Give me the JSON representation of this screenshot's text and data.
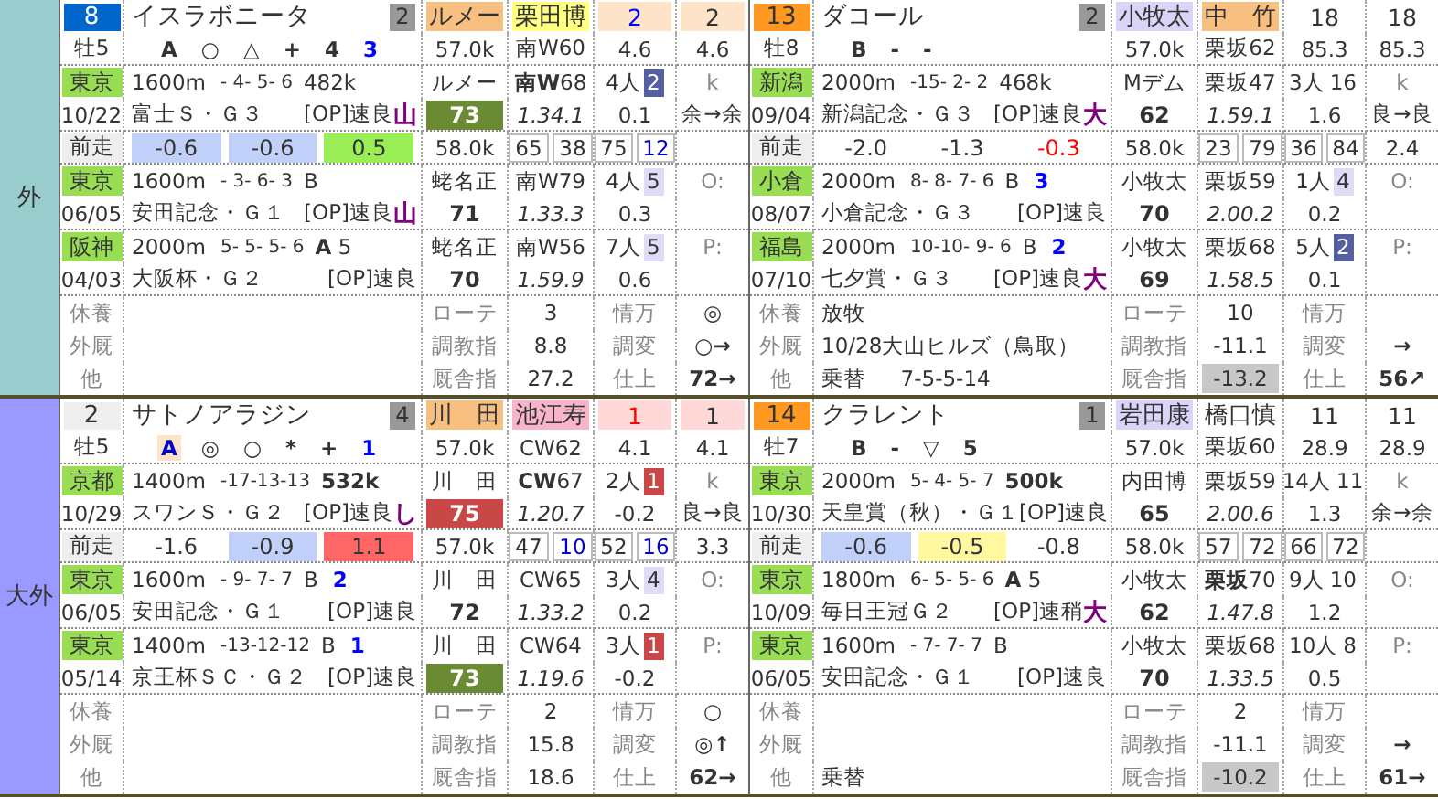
{
  "groups": [
    {
      "label": "外",
      "color": "#99cccc",
      "horses": [
        {
          "frame": {
            "number": "8",
            "color": "#0066cc"
          },
          "name": "イスラボニータ",
          "rank": "2",
          "sex_age": "牡5",
          "marks": [
            {
              "text": "A"
            },
            {
              "text": "○"
            },
            {
              "text": "△"
            },
            {
              "text": "+"
            },
            {
              "text": "4"
            },
            {
              "text": "3",
              "color": "#0000ff"
            }
          ],
          "top": [
            {
              "text": "ルメー",
              "fill": {
                "color": "#f8c080"
              }
            },
            {
              "text": "栗田博",
              "fill": {
                "color": "#ffff80"
              }
            },
            {
              "text": "2",
              "color": "#0000ff",
              "fill": {
                "color": "#fde4c8"
              }
            },
            {
              "text": "2",
              "fill": {
                "color": "#fde4c8"
              }
            }
          ],
          "second": [
            "57.0k",
            "南W60",
            "4.6",
            "4.6"
          ],
          "races": [
            {
              "venue": "東京",
              "date": "10/22",
              "distance": "1600m",
              "passing": "- 4- 5- 6",
              "tag": "482k",
              "name": "富士Ｓ・Ｇ３",
              "class": "[OP]速良",
              "mark": "山",
              "jockey": "ルメー",
              "rating": {
                "text": "73",
                "color": "#6b8a34"
              },
              "course": "**南W**68",
              "time": "1.34.1",
              "pop": "4人",
              "pop_rank": {
                "text": "2",
                "color": "#5560a0"
              },
              "diff": "0.1",
              "note": "k",
              "note2": "余→余"
            },
            {
              "venue": "東京",
              "date": "06/05",
              "distance": "1600m",
              "passing": "- 3- 6- 3",
              "tag": "B",
              "name": "安田記念・Ｇ１",
              "class": "[OP]速良",
              "mark": "山",
              "jockey": "蛯名正",
              "rating": {
                "text": "71"
              },
              "course": "南W79",
              "time": "1.33.3",
              "pop": "4人",
              "pop_rank": {
                "text": "5",
                "color": "#e0dcf8"
              },
              "diff": "0.3",
              "note": "O:"
            },
            {
              "venue": "阪神",
              "date": "04/03",
              "distance": "2000m",
              "passing": "5- 5- 5- 6",
              "tag": "**A** 5",
              "name": "大阪杯・Ｇ２",
              "class": "[OP]速良",
              "jockey": "蛯名正",
              "rating": {
                "text": "70"
              },
              "course": "南W56",
              "time": "1.59.9",
              "pop": "7人",
              "pop_rank": {
                "text": "5",
                "color": "#e0dcf8"
              },
              "diff": "0.6",
              "note": "P:"
            }
          ],
          "last": {
            "label": "前走",
            "diffs": [
              {
                "text": "-0.6",
                "fill": {
                  "color": "#c0d0f8"
                }
              },
              {
                "text": "-0.6",
                "fill": {
                  "color": "#c0d0f8"
                }
              },
              {
                "text": "0.5",
                "fill": {
                  "color": "#99ee55"
                }
              }
            ],
            "weight": "58.0k",
            "pairs": [
              [
                {
                  "text": "65"
                },
                {
                  "text": "38"
                }
              ],
              [
                {
                  "text": "75"
                },
                {
                  "text": "12",
                  "color": "#0000cc"
                }
              ]
            ]
          },
          "info": [
            {
              "label": "休養"
            },
            {
              "label": "外厩"
            },
            {
              "label": "他"
            }
          ],
          "indices": [
            {
              "label": "ローテ",
              "value": "3",
              "label2": "情万",
              "mark": "◎"
            },
            {
              "label": "調教指",
              "value": "8.8",
              "label2": "調変",
              "mark": "○→"
            },
            {
              "label": "厩舎指",
              "value": "27.2",
              "label2": "仕上",
              "mark": "72→"
            }
          ]
        },
        {
          "frame": {
            "number": "13",
            "color": "#ff9922"
          },
          "name": "ダコール",
          "rank": "2",
          "sex_age": "牡8",
          "marks": [
            {
              "text": "B"
            },
            {
              "text": "-"
            },
            {
              "text": "-"
            }
          ],
          "top": [
            {
              "text": "小牧太",
              "fill": {
                "color": "#dcd4f8"
              }
            },
            {
              "text": "中　竹",
              "fill": {
                "color": "#f8c080"
              }
            },
            {
              "text": "18"
            },
            {
              "text": "18"
            }
          ],
          "second": [
            "57.0k",
            "栗坂62",
            "85.3",
            "85.3"
          ],
          "races": [
            {
              "venue": "新潟",
              "date": "09/04",
              "distance": "2000m",
              "passing": "-15- 2- 2",
              "tag": "468k",
              "name": "新潟記念・Ｇ３",
              "class": "[OP]速良",
              "mark": "大",
              "jockey": "Mデム",
              "rating": {
                "text": "62"
              },
              "course": "栗坂47",
              "time": "1.59.1",
              "pop": "3人",
              "pop_rank": {
                "text": "16"
              },
              "diff": "1.6",
              "note": "k",
              "note2": "良→良"
            },
            {
              "venue": "小倉",
              "date": "08/07",
              "distance": "2000m",
              "passing": "8- 8- 7- 6",
              "tag": "B",
              "num": "3",
              "name": "小倉記念・Ｇ３",
              "class": "[OP]速良",
              "jockey": "小牧太",
              "rating": {
                "text": "70"
              },
              "course": "栗坂59",
              "time": "2.00.2",
              "pop": "1人",
              "pop_rank": {
                "text": "4",
                "color": "#e0dcf8"
              },
              "diff": "0.2",
              "note": "O:"
            },
            {
              "venue": "福島",
              "date": "07/10",
              "distance": "2000m",
              "passing": "10-10- 9- 6",
              "tag": "B",
              "num": "2",
              "name": "七夕賞・Ｇ３",
              "class": "[OP]速良",
              "mark": "大",
              "jockey": "小牧太",
              "rating": {
                "text": "69"
              },
              "course": "栗坂68",
              "time": "1.58.5",
              "pop": "5人",
              "pop_rank": {
                "text": "2",
                "color": "#5560a0"
              },
              "diff": "0.1",
              "note": "P:"
            }
          ],
          "last": {
            "label": "前走",
            "diffs": [
              {
                "text": "-2.0"
              },
              {
                "text": "-1.3"
              },
              {
                "text": "-0.3",
                "color": "#ff0000"
              }
            ],
            "weight": "58.0k",
            "pairs": [
              [
                {
                  "text": "23"
                },
                {
                  "text": "79"
                }
              ],
              [
                {
                  "text": "36"
                },
                {
                  "text": "84"
                }
              ]
            ],
            "value": "2.4"
          },
          "info": [
            {
              "label": "休養",
              "text": "放牧"
            },
            {
              "label": "外厩",
              "text": "10/28大山ヒルズ（鳥取）"
            },
            {
              "label": "他",
              "text": "乗替　  7-5-5-14"
            }
          ],
          "indices": [
            {
              "label": "ローテ",
              "value": "10",
              "label2": "情万"
            },
            {
              "label": "調教指",
              "value": "-11.1",
              "label2": "調変",
              "mark": "→"
            },
            {
              "label": "厩舎指",
              "value": "-13.2",
              "shaded": true,
              "label2": "仕上",
              "mark": "56↗"
            }
          ]
        }
      ]
    },
    {
      "label": "大外",
      "color": "#9999ff",
      "horses": [
        {
          "frame": {
            "number": "2",
            "color": "#eeeeee"
          },
          "name": "サトノアラジン",
          "rank": "4",
          "sex_age": "牡5",
          "marks": [
            {
              "text": "A",
              "color": "#0000cc",
              "highlighted": true
            },
            {
              "text": "◎"
            },
            {
              "text": "○"
            },
            {
              "text": "*"
            },
            {
              "text": "+"
            },
            {
              "text": "1",
              "color": "#0000ff"
            }
          ],
          "top": [
            {
              "text": "川　田",
              "fill": {
                "color": "#f8c080"
              }
            },
            {
              "text": "池江寿",
              "fill": {
                "color": "#f8b4c8"
              }
            },
            {
              "text": "1",
              "color": "#ff0000",
              "fill": {
                "color": "#ffd8d8"
              }
            },
            {
              "text": "1",
              "fill": {
                "color": "#ffd8d8"
              }
            }
          ],
          "second": [
            "57.0k",
            "CW62",
            "4.1",
            "4.1"
          ],
          "races": [
            {
              "venue": "京都",
              "date": "10/29",
              "distance": "1400m",
              "passing": "-17-13-13",
              "tag": "532k",
              "tag_bold": true,
              "name": "スワンＳ・Ｇ２",
              "class": "[OP]速良",
              "mark": "し",
              "jockey": "川　田",
              "rating": {
                "text": "75",
                "color": "#c84848"
              },
              "course": "**CW**67",
              "time": "1.20.7",
              "pop": "2人",
              "pop_rank": {
                "text": "1",
                "color": "#c84848"
              },
              "diff": "-0.2",
              "note": "k",
              "note2": "良→良"
            },
            {
              "venue": "東京",
              "date": "06/05",
              "distance": "1600m",
              "passing": "- 9- 7- 7",
              "tag": "B",
              "num": "2",
              "name": "安田記念・Ｇ１",
              "class": "[OP]速良",
              "jockey": "川　田",
              "rating": {
                "text": "72"
              },
              "course": "CW65",
              "time": "1.33.2",
              "pop": "3人",
              "pop_rank": {
                "text": "4",
                "color": "#e0dcf8"
              },
              "diff": "0.2",
              "note": "O:"
            },
            {
              "venue": "東京",
              "date": "05/14",
              "distance": "1400m",
              "passing": "-13-12-12",
              "tag": "B",
              "num": "1",
              "name": "京王杯ＳＣ・Ｇ２",
              "class": "[OP]速良",
              "jockey": "川　田",
              "rating": {
                "text": "73",
                "color": "#6b8a34"
              },
              "course": "CW64",
              "time": "1.19.6",
              "pop": "3人",
              "pop_rank": {
                "text": "1",
                "color": "#c84848"
              },
              "diff": "-0.2",
              "note": "P:"
            }
          ],
          "last": {
            "label": "前走",
            "diffs": [
              {
                "text": "-1.6"
              },
              {
                "text": "-0.9",
                "fill": {
                  "color": "#c0d0f8"
                }
              },
              {
                "text": "1.1",
                "fill": {
                  "color": "#ff6666"
                }
              }
            ],
            "weight": "57.0k",
            "pairs": [
              [
                {
                  "text": "47"
                },
                {
                  "text": "10",
                  "color": "#0000cc"
                }
              ],
              [
                {
                  "text": "52"
                },
                {
                  "text": "16",
                  "color": "#0000cc"
                }
              ]
            ],
            "value": "3.3"
          },
          "info": [
            {
              "label": "休養"
            },
            {
              "label": "外厩"
            },
            {
              "label": "他"
            }
          ],
          "indices": [
            {
              "label": "ローテ",
              "value": "2",
              "label2": "情万",
              "mark": "○"
            },
            {
              "label": "調教指",
              "value": "15.8",
              "label2": "調変",
              "mark": "◎↑"
            },
            {
              "label": "厩舎指",
              "value": "18.6",
              "label2": "仕上",
              "mark": "62→"
            }
          ]
        },
        {
          "frame": {
            "number": "14",
            "color": "#ff9922"
          },
          "name": "クラレント",
          "rank": "1",
          "sex_age": "牡7",
          "marks": [
            {
              "text": "B"
            },
            {
              "text": "-"
            },
            {
              "text": "▽"
            },
            {
              "text": "5"
            }
          ],
          "top": [
            {
              "text": "岩田康",
              "fill": {
                "color": "#dcd4f8"
              }
            },
            {
              "text": "橋口慎"
            },
            {
              "text": "11"
            },
            {
              "text": "11"
            }
          ],
          "second": [
            "57.0k",
            "栗坂60",
            "28.9",
            "28.9"
          ],
          "races": [
            {
              "venue": "東京",
              "date": "10/30",
              "distance": "2000m",
              "passing": "5- 4- 5- 7",
              "tag": "500k",
              "tag_bold": true,
              "name": "天皇賞（秋）・Ｇ１",
              "class": "[OP]速良",
              "jockey": "内田博",
              "rating": {
                "text": "65"
              },
              "course": "栗坂59",
              "time": "2.00.6",
              "pop": "14人",
              "pop_rank": {
                "text": "11"
              },
              "diff": "1.3",
              "note": "k",
              "note2": "余→余"
            },
            {
              "venue": "東京",
              "date": "10/09",
              "distance": "1800m",
              "passing": "6- 5- 5- 6",
              "tag": "**A** 5",
              "name": "毎日王冠Ｇ２",
              "class": "[OP]速稍",
              "mark": "大",
              "jockey": "小牧太",
              "rating": {
                "text": "62"
              },
              "course": "**栗坂**70",
              "time": "1.47.8",
              "pop": "9人",
              "pop_rank": {
                "text": "10"
              },
              "diff": "1.2",
              "note": "O:"
            },
            {
              "venue": "東京",
              "date": "06/05",
              "distance": "1600m",
              "passing": "- 7- 7- 7",
              "tag": "B",
              "name": "安田記念・Ｇ１",
              "class": "[OP]速良",
              "jockey": "小牧太",
              "rating": {
                "text": "70"
              },
              "course": "栗坂68",
              "time": "1.33.5",
              "pop": "10人",
              "pop_rank": {
                "text": "8"
              },
              "diff": "0.5",
              "note": "P:"
            }
          ],
          "last": {
            "label": "前走",
            "diffs": [
              {
                "text": "-0.6",
                "fill": {
                  "color": "#c0d0f8"
                }
              },
              {
                "text": "-0.5",
                "fill": {
                  "color": "#fff8a0"
                }
              },
              {
                "text": "-0.8"
              }
            ],
            "weight": "58.0k",
            "pairs": [
              [
                {
                  "text": "57"
                },
                {
                  "text": "72"
                }
              ],
              [
                {
                  "text": "66"
                },
                {
                  "text": "72"
                }
              ]
            ]
          },
          "info": [
            {
              "label": "休養"
            },
            {
              "label": "外厩"
            },
            {
              "label": "他",
              "text": "乗替"
            }
          ],
          "indices": [
            {
              "label": "ローテ",
              "value": "2",
              "label2": "情万"
            },
            {
              "label": "調教指",
              "value": "-11.1",
              "label2": "調変",
              "mark": "→"
            },
            {
              "label": "厩舎指",
              "value": "-10.2",
              "shaded": true,
              "label2": "仕上",
              "mark": "61→"
            }
          ]
        }
      ]
    }
  ]
}
